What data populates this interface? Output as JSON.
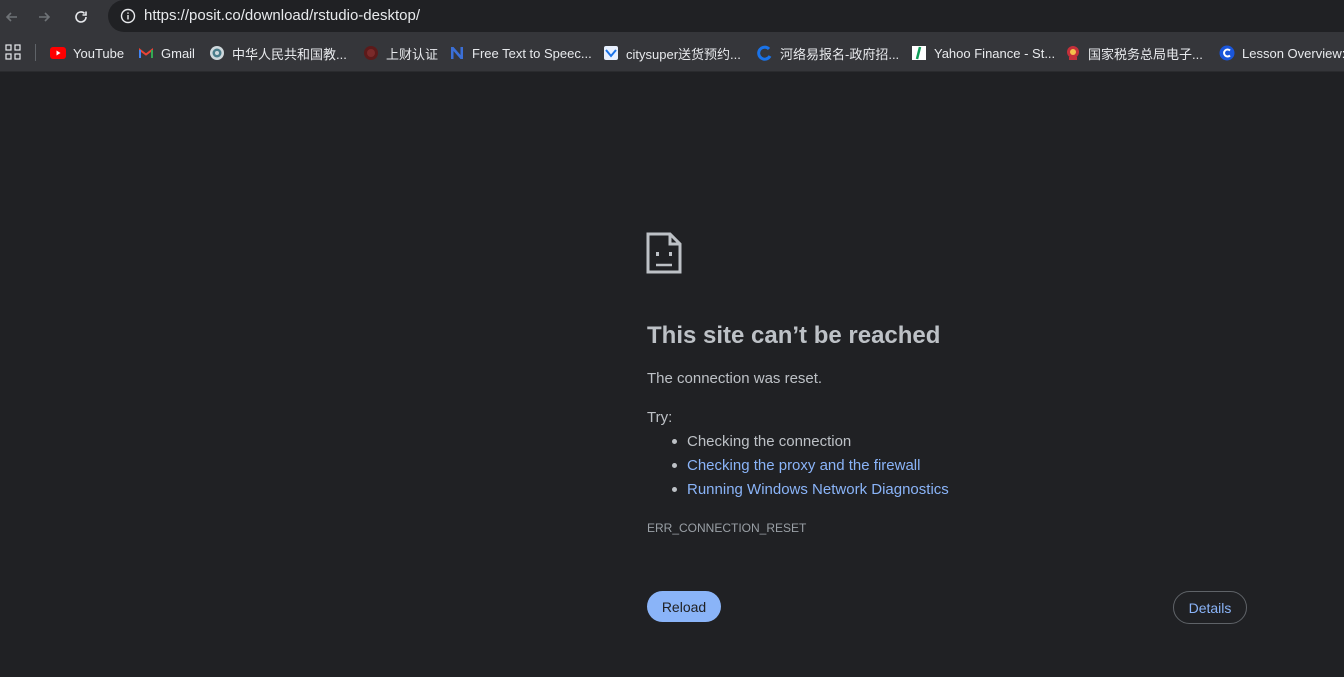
{
  "browser": {
    "url": "https://posit.co/download/rstudio-desktop/",
    "bookmarks": [
      {
        "label": "YouTube",
        "icon": "youtube-icon"
      },
      {
        "label": "Gmail",
        "icon": "gmail-icon"
      },
      {
        "label": "中华人民共和国教...",
        "icon": "globe-icon"
      },
      {
        "label": "上财认证",
        "icon": "university-icon"
      },
      {
        "label": "Free Text to Speec...",
        "icon": "n-logo-icon"
      },
      {
        "label": "citysuper送货预约...",
        "icon": "citysuper-icon"
      },
      {
        "label": "河络易报名-政府招...",
        "icon": "c-swirl-icon"
      },
      {
        "label": "Yahoo Finance - St...",
        "icon": "yahoo-finance-icon"
      },
      {
        "label": "国家税务总局电子...",
        "icon": "tax-emblem-icon"
      },
      {
        "label": "Lesson Overview:...",
        "icon": "c-logo-icon"
      }
    ]
  },
  "error_page": {
    "title": "This site can’t be reached",
    "description": "The connection was reset.",
    "try_label": "Try:",
    "suggestions": [
      {
        "text": "Checking the connection",
        "is_link": false
      },
      {
        "text": "Checking the proxy and the firewall",
        "is_link": true
      },
      {
        "text": "Running Windows Network Diagnostics",
        "is_link": true
      }
    ],
    "error_code": "ERR_CONNECTION_RESET",
    "reload_label": "Reload",
    "details_label": "Details"
  },
  "colors": {
    "background": "#202124",
    "toolbar": "#35363a",
    "text": "#bdc1c6",
    "link": "#8ab4f8"
  }
}
